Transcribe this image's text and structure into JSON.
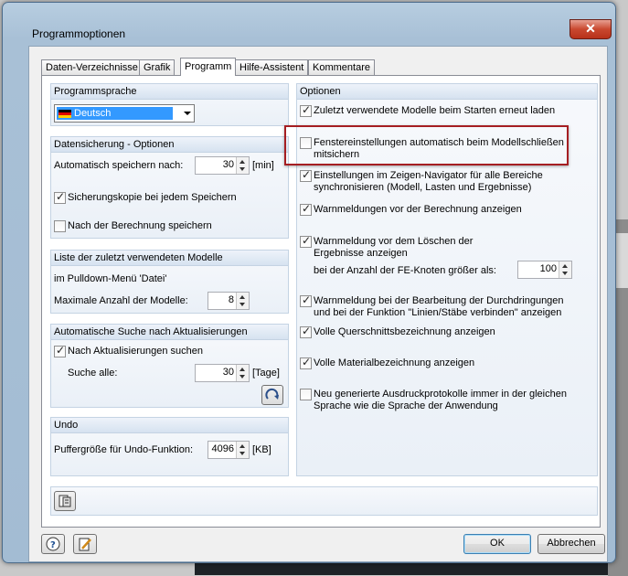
{
  "window": {
    "title": "Programmoptionen",
    "close_label": "✕"
  },
  "tabs": [
    {
      "label": "Daten-Verzeichnisse"
    },
    {
      "label": "Grafik"
    },
    {
      "label": "Programm"
    },
    {
      "label": "Hilfe-Assistent"
    },
    {
      "label": "Kommentare"
    }
  ],
  "programmsprache": {
    "header": "Programmsprache",
    "selected": "Deutsch"
  },
  "datensicherung": {
    "header": "Datensicherung - Optionen",
    "autosave_label": "Automatisch speichern nach:",
    "autosave_value": "30",
    "autosave_unit": "[min]",
    "backup_label": "Sicherungskopie bei jedem Speichern",
    "backup_checked": true,
    "after_calc_label": "Nach der Berechnung speichern",
    "after_calc_checked": false
  },
  "zuletzt": {
    "header": "Liste der zuletzt verwendeten Modelle",
    "pulldown_label": "im Pulldown-Menü 'Datei'",
    "max_label": "Maximale Anzahl der Modelle:",
    "max_value": "8"
  },
  "updates": {
    "header": "Automatische Suche nach Aktualisierungen",
    "search_label": "Nach Aktualisierungen suchen",
    "search_checked": true,
    "interval_label": "Suche alle:",
    "interval_value": "30",
    "interval_unit": "[Tage]"
  },
  "undo": {
    "header": "Undo",
    "buffer_label": "Puffergröße für Undo-Funktion:",
    "buffer_value": "4096",
    "buffer_unit": "[KB]"
  },
  "optionen": {
    "header": "Optionen",
    "items": [
      {
        "label": "Zuletzt verwendete Modelle beim Starten erneut laden",
        "checked": true
      },
      {
        "label_1": "Fenstereinstellungen automatisch beim Modellschließen",
        "label_2": "mitsichern",
        "checked": false
      },
      {
        "label_1": "Einstellungen im Zeigen-Navigator für alle Bereiche",
        "label_2": "synchronisieren (Modell, Lasten und Ergebnisse)",
        "checked": true
      },
      {
        "label": "Warnmeldungen vor der Berechnung anzeigen",
        "checked": true
      },
      {
        "label_1": "Warnmeldung vor dem Löschen der",
        "label_2": "Ergebnisse anzeigen",
        "checked": true
      },
      {
        "label_1": "Warnmeldung bei der Bearbeitung der Durchdringungen",
        "label_2": "und bei der Funktion \"Linien/Stäbe verbinden\" anzeigen",
        "checked": true
      },
      {
        "label": "Volle Querschnittsbezeichnung anzeigen",
        "checked": true
      },
      {
        "label": "Volle Materialbezeichnung anzeigen",
        "checked": true
      },
      {
        "label_1": "Neu generierte Ausdruckprotokolle immer in der gleichen",
        "label_2": "Sprache wie die Sprache der Anwendung",
        "checked": false
      }
    ],
    "fe_nodes_label": "bei der Anzahl der FE-Knoten größer als:",
    "fe_nodes_value": "100"
  },
  "footer": {
    "ok_label": "OK",
    "cancel_label": "Abbrechen"
  },
  "icons": [
    "refresh-icon",
    "default-settings-icon",
    "help-icon",
    "edit-icon"
  ]
}
